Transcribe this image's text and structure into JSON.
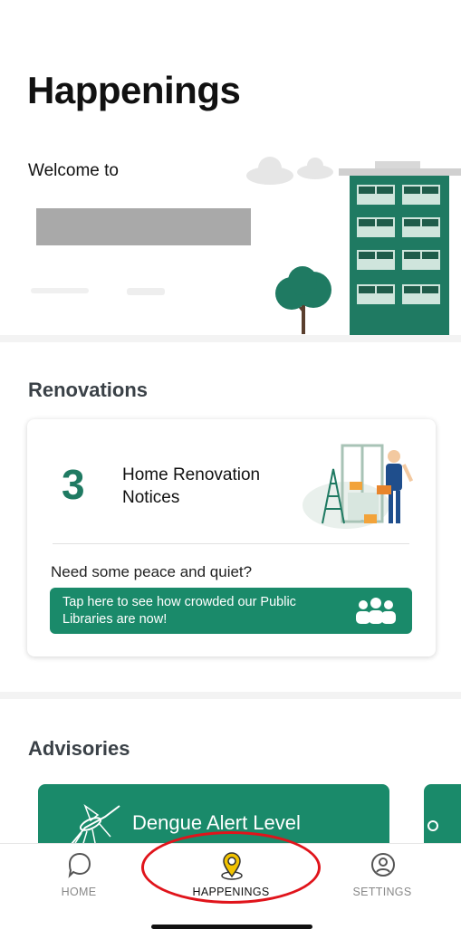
{
  "header": {
    "title": "Happenings",
    "welcome": "Welcome to"
  },
  "renovations": {
    "section_title": "Renovations",
    "notice_count": "3",
    "notice_label": "Home Renovation Notices",
    "prompt": "Need some peace and quiet?",
    "library_banner": "Tap here to see how crowded our Public Libraries are now!"
  },
  "advisories": {
    "section_title": "Advisories",
    "cards": [
      {
        "label": "Dengue Alert Level"
      }
    ]
  },
  "tabs": [
    {
      "label": "HOME",
      "icon": "home-chat-icon",
      "active": false
    },
    {
      "label": "HAPPENINGS",
      "icon": "location-pin-icon",
      "active": true
    },
    {
      "label": "SETTINGS",
      "icon": "user-circle-icon",
      "active": false
    }
  ],
  "colors": {
    "accent_green": "#1a8a6a",
    "count_green": "#1f7a62",
    "active_tab_yellow": "#f2c300",
    "annotation_red": "#e0141b"
  }
}
